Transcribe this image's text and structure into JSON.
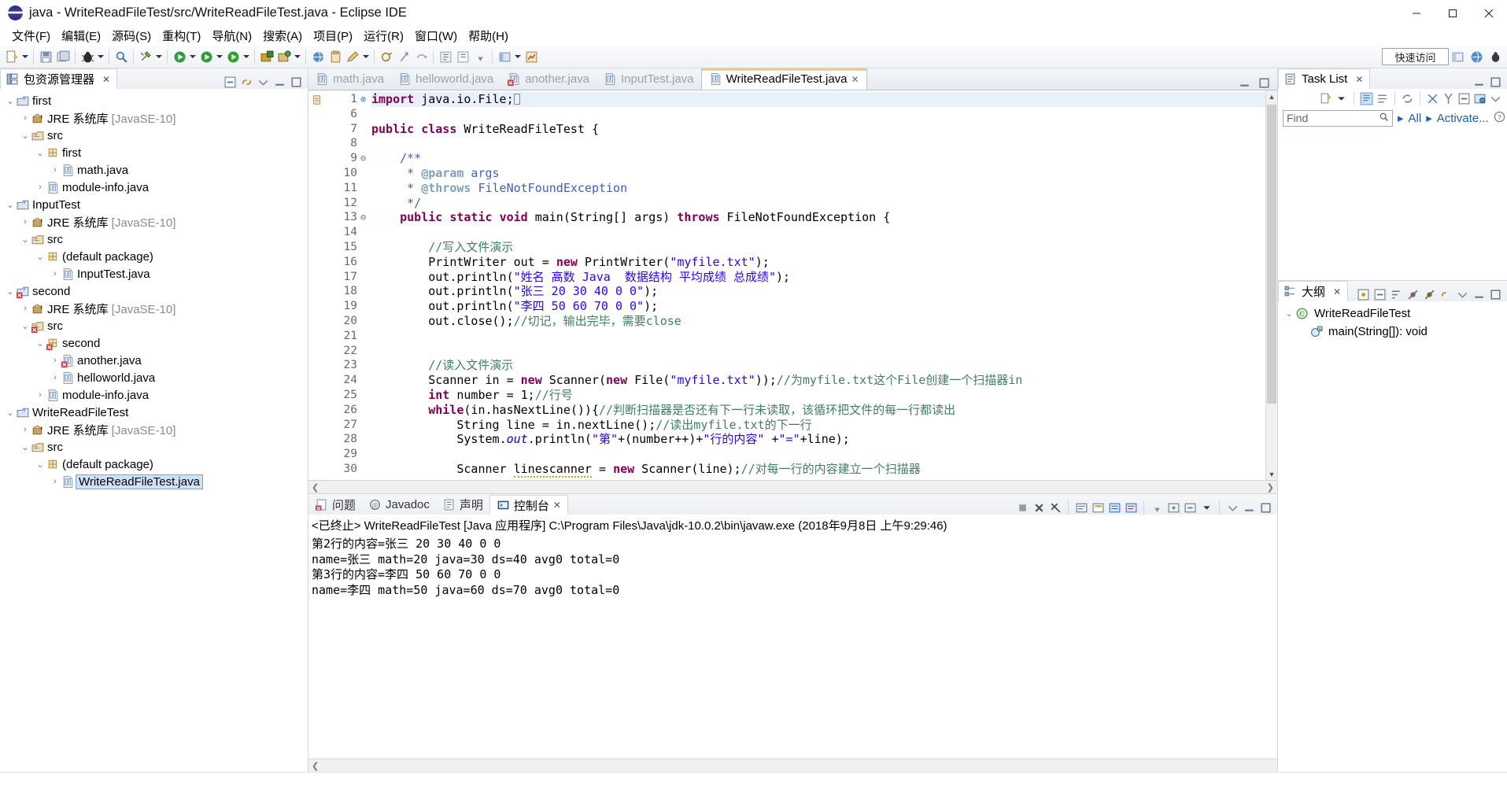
{
  "window": {
    "title": "java - WriteReadFileTest/src/WriteReadFileTest.java - Eclipse IDE",
    "minimize_label": "—",
    "maximize_label": "❐",
    "close_label": "✕"
  },
  "menubar": {
    "items": [
      {
        "label": "文件(F)"
      },
      {
        "label": "编辑(E)"
      },
      {
        "label": "源码(S)"
      },
      {
        "label": "重构(T)"
      },
      {
        "label": "导航(N)"
      },
      {
        "label": "搜索(A)"
      },
      {
        "label": "项目(P)"
      },
      {
        "label": "运行(R)"
      },
      {
        "label": "窗口(W)"
      },
      {
        "label": "帮助(H)"
      }
    ]
  },
  "toolbar": {
    "quick_access": "快速访问"
  },
  "package_explorer": {
    "title": "包资源管理器",
    "close_label": "✕",
    "tree": [
      {
        "indent": 0,
        "twisty": "v",
        "icon": "project-java-icon",
        "label": "first",
        "error": false,
        "selected": false
      },
      {
        "indent": 1,
        "twisty": ">",
        "icon": "jre-library-icon",
        "label": "JRE 系统库",
        "suffix": " [JavaSE-10]",
        "error": false,
        "selected": false
      },
      {
        "indent": 1,
        "twisty": "v",
        "icon": "source-folder-icon",
        "label": "src",
        "error": false,
        "selected": false
      },
      {
        "indent": 2,
        "twisty": "v",
        "icon": "package-icon",
        "label": "first",
        "error": false,
        "selected": false
      },
      {
        "indent": 3,
        "twisty": ">",
        "icon": "java-file-icon",
        "label": "math.java",
        "error": false,
        "selected": false
      },
      {
        "indent": 2,
        "twisty": ">",
        "icon": "java-file-icon",
        "label": "module-info.java",
        "error": false,
        "selected": false
      },
      {
        "indent": 0,
        "twisty": "v",
        "icon": "project-java-icon",
        "label": "InputTest",
        "error": false,
        "selected": false
      },
      {
        "indent": 1,
        "twisty": ">",
        "icon": "jre-library-icon",
        "label": "JRE 系统库",
        "suffix": " [JavaSE-10]",
        "error": false,
        "selected": false
      },
      {
        "indent": 1,
        "twisty": "v",
        "icon": "source-folder-icon",
        "label": "src",
        "error": false,
        "selected": false
      },
      {
        "indent": 2,
        "twisty": "v",
        "icon": "package-icon",
        "label": "(default package)",
        "error": false,
        "selected": false
      },
      {
        "indent": 3,
        "twisty": ">",
        "icon": "java-file-icon",
        "label": "InputTest.java",
        "error": false,
        "selected": false
      },
      {
        "indent": 0,
        "twisty": "v",
        "icon": "project-java-icon",
        "label": "second",
        "error": true,
        "selected": false
      },
      {
        "indent": 1,
        "twisty": ">",
        "icon": "jre-library-icon",
        "label": "JRE 系统库",
        "suffix": " [JavaSE-10]",
        "error": false,
        "selected": false
      },
      {
        "indent": 1,
        "twisty": "v",
        "icon": "source-folder-icon",
        "label": "src",
        "error": true,
        "selected": false
      },
      {
        "indent": 2,
        "twisty": "v",
        "icon": "package-icon",
        "label": "second",
        "error": true,
        "selected": false
      },
      {
        "indent": 3,
        "twisty": ">",
        "icon": "java-file-icon",
        "label": "another.java",
        "error": true,
        "selected": false
      },
      {
        "indent": 3,
        "twisty": ">",
        "icon": "java-file-icon",
        "label": "helloworld.java",
        "error": false,
        "selected": false
      },
      {
        "indent": 2,
        "twisty": ">",
        "icon": "java-file-icon",
        "label": "module-info.java",
        "error": false,
        "selected": false
      },
      {
        "indent": 0,
        "twisty": "v",
        "icon": "project-java-icon",
        "label": "WriteReadFileTest",
        "error": false,
        "selected": false
      },
      {
        "indent": 1,
        "twisty": ">",
        "icon": "jre-library-icon",
        "label": "JRE 系统库",
        "suffix": " [JavaSE-10]",
        "error": false,
        "selected": false
      },
      {
        "indent": 1,
        "twisty": "v",
        "icon": "source-folder-icon",
        "label": "src",
        "error": false,
        "selected": false
      },
      {
        "indent": 2,
        "twisty": "v",
        "icon": "package-icon",
        "label": "(default package)",
        "error": false,
        "selected": false
      },
      {
        "indent": 3,
        "twisty": ">",
        "icon": "java-file-icon",
        "label": "WriteReadFileTest.java",
        "error": false,
        "selected": true
      }
    ]
  },
  "editor": {
    "tabs": [
      {
        "label": "math.java",
        "active": false,
        "error": false
      },
      {
        "label": "helloworld.java",
        "active": false,
        "error": false
      },
      {
        "label": "another.java",
        "active": false,
        "error": true
      },
      {
        "label": "InputTest.java",
        "active": false,
        "error": false
      },
      {
        "label": "WriteReadFileTest.java",
        "active": true,
        "error": false
      }
    ],
    "close_label": "✕",
    "minimize_label": "▭",
    "maximize_label": "❐",
    "line_numbers": [
      "1",
      "6",
      "7",
      "8",
      "9",
      "10",
      "11",
      "12",
      "13",
      "14",
      "15",
      "16",
      "17",
      "18",
      "19",
      "20",
      "21",
      "22",
      "23",
      "24",
      "25",
      "26",
      "27",
      "28",
      "29",
      "30"
    ],
    "fold_markers": [
      "⊕",
      "",
      "",
      "",
      "⊖",
      "",
      "",
      "",
      "⊖",
      "",
      "",
      "",
      "",
      "",
      "",
      "",
      "",
      "",
      "",
      "",
      "",
      "",
      "",
      "",
      "",
      ""
    ],
    "code_lines": [
      "import java.io.File;",
      "",
      "public class WriteReadFileTest {",
      "",
      "    /**",
      "     * @param args",
      "     * @throws FileNotFoundException",
      "     */",
      "    public static void main(String[] args) throws FileNotFoundException {",
      "",
      "        //写入文件演示",
      "        PrintWriter out = new PrintWriter(\"myfile.txt\");",
      "        out.println(\"姓名 高数 Java  数据结构 平均成绩 总成绩\");",
      "        out.println(\"张三 20 30 40 0 0\");",
      "        out.println(\"李四 50 60 70 0 0\");",
      "        out.close();//切记，输出完毕，需要close",
      "",
      "",
      "        //读入文件演示",
      "        Scanner in = new Scanner(new File(\"myfile.txt\"));//为myfile.txt这个File创建一个扫描器in",
      "        int number = 1;//行号",
      "        while(in.hasNextLine()){//判断扫描器是否还有下一行未读取，该循环把文件的每一行都读出",
      "            String line = in.nextLine();//读出myfile.txt的下一行",
      "            System.out.println(\"第\"+(number++)+\"行的内容\" +\"=\"+line);",
      "",
      "            Scanner linescanner = new Scanner(line);//对每一行的内容建立一个扫描器"
    ]
  },
  "console": {
    "tabs": [
      {
        "label": "问题",
        "icon": "problems-icon",
        "active": false
      },
      {
        "label": "Javadoc",
        "icon": "javadoc-icon",
        "active": false
      },
      {
        "label": "声明",
        "icon": "declaration-icon",
        "active": false
      },
      {
        "label": "控制台",
        "icon": "console-icon",
        "active": true
      }
    ],
    "close_label": "✕",
    "header": "<已终止> WriteReadFileTest [Java 应用程序] C:\\Program Files\\Java\\jdk-10.0.2\\bin\\javaw.exe  (2018年9月8日 上午9:29:46)",
    "output": [
      "第2行的内容=张三 20 30 40 0 0",
      "name=张三 math=20 java=30 ds=40 avg0 total=0",
      "第3行的内容=李四 50 60 70 0 0",
      "name=李四 math=50 java=60 ds=70 avg0 total=0"
    ]
  },
  "task_list": {
    "title": "Task List",
    "close_label": "✕",
    "find_placeholder": "Find",
    "all_label": "All",
    "activate_label": "Activate...",
    "minimize_label": "▭",
    "maximize_label": "❐"
  },
  "outline": {
    "title": "大纲",
    "close_label": "✕",
    "minimize_label": "▭",
    "maximize_label": "❐",
    "items": [
      {
        "indent": 0,
        "twisty": "v",
        "icon": "class-icon",
        "label": "WriteReadFileTest",
        "suffix": ""
      },
      {
        "indent": 1,
        "twisty": "",
        "icon": "method-static-icon",
        "label": "main(String[])",
        "suffix": " : void"
      }
    ]
  },
  "statusbar": {
    "text": ""
  },
  "colors": {
    "keyword": "#7f0055",
    "string": "#2a00ff",
    "comment": "#3f7f5f",
    "javadoc": "#3f5fbf",
    "link": "#1f5fa9",
    "selection": "#cde2f7",
    "error": "#d13438"
  }
}
